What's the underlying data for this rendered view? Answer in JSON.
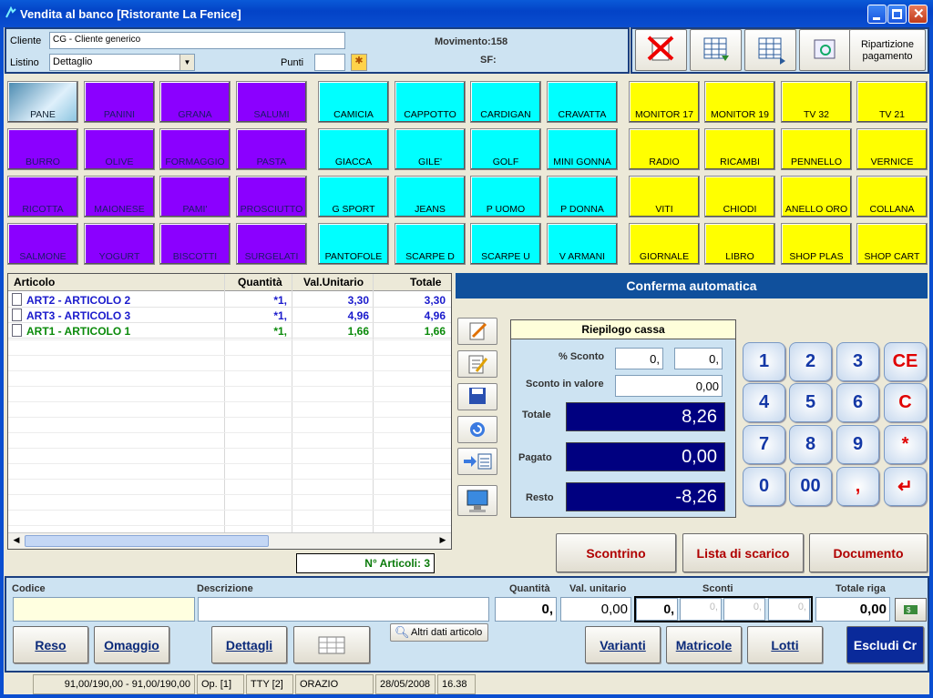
{
  "window": {
    "title": "Vendita al banco [Ristorante La Fenice]"
  },
  "header": {
    "cliente_label": "Cliente",
    "cliente_value": "CG - Cliente generico",
    "listino_label": "Listino",
    "listino_value": "Dettaglio",
    "punti_label": "Punti",
    "punti_value": "",
    "movimento": "Movimento:158",
    "sf": "SF:"
  },
  "toolbar": {
    "ripartizione_label": "Ripartizione pagamento"
  },
  "products": [
    {
      "label": "PANE",
      "color": "purple"
    },
    {
      "label": "PANINI",
      "color": "purple"
    },
    {
      "label": "GRANA",
      "color": "purple"
    },
    {
      "label": "SALUMI",
      "color": "purple"
    },
    {
      "label": "CAMICIA",
      "color": "cyan"
    },
    {
      "label": "CAPPOTTO",
      "color": "cyan"
    },
    {
      "label": "CARDIGAN",
      "color": "cyan"
    },
    {
      "label": "CRAVATTA",
      "color": "cyan"
    },
    {
      "label": "MONITOR 17",
      "color": "yellow"
    },
    {
      "label": "MONITOR 19",
      "color": "yellow"
    },
    {
      "label": "TV 32",
      "color": "yellow"
    },
    {
      "label": "TV 21",
      "color": "yellow"
    },
    {
      "label": "BURRO",
      "color": "purple"
    },
    {
      "label": "OLIVE",
      "color": "purple"
    },
    {
      "label": "FORMAGGIO",
      "color": "purple"
    },
    {
      "label": "PASTA",
      "color": "purple"
    },
    {
      "label": "GIACCA",
      "color": "cyan"
    },
    {
      "label": "GILE'",
      "color": "cyan"
    },
    {
      "label": "GOLF",
      "color": "cyan"
    },
    {
      "label": "MINI GONNA",
      "color": "cyan"
    },
    {
      "label": "RADIO",
      "color": "yellow"
    },
    {
      "label": "RICAMBI",
      "color": "yellow"
    },
    {
      "label": "PENNELLO",
      "color": "yellow"
    },
    {
      "label": "VERNICE",
      "color": "yellow"
    },
    {
      "label": "RICOTTA",
      "color": "purple"
    },
    {
      "label": "MAIONESE",
      "color": "purple"
    },
    {
      "label": "PAMI'",
      "color": "purple"
    },
    {
      "label": "PROSCIUTTO",
      "color": "purple"
    },
    {
      "label": "G SPORT",
      "color": "cyan"
    },
    {
      "label": "JEANS",
      "color": "cyan"
    },
    {
      "label": "P UOMO",
      "color": "cyan"
    },
    {
      "label": "P DONNA",
      "color": "cyan"
    },
    {
      "label": "VITI",
      "color": "yellow"
    },
    {
      "label": "CHIODI",
      "color": "yellow"
    },
    {
      "label": "ANELLO ORO",
      "color": "yellow"
    },
    {
      "label": "COLLANA",
      "color": "yellow"
    },
    {
      "label": "SALMONE",
      "color": "purple"
    },
    {
      "label": "YOGURT",
      "color": "purple"
    },
    {
      "label": "BISCOTTI",
      "color": "purple"
    },
    {
      "label": "SURGELATI",
      "color": "purple"
    },
    {
      "label": "PANTOFOLE",
      "color": "cyan"
    },
    {
      "label": "SCARPE D",
      "color": "cyan"
    },
    {
      "label": "SCARPE U",
      "color": "cyan"
    },
    {
      "label": "V ARMANI",
      "color": "cyan"
    },
    {
      "label": "GIORNALE",
      "color": "yellow"
    },
    {
      "label": "LIBRO",
      "color": "yellow"
    },
    {
      "label": "SHOP PLAS",
      "color": "yellow"
    },
    {
      "label": "SHOP CART",
      "color": "yellow"
    }
  ],
  "grid": {
    "headers": [
      "Articolo",
      "Quantità",
      "Val.Unitario",
      "Totale"
    ],
    "rows": [
      {
        "articolo": "ART2 - ARTICOLO 2",
        "quantita": "*1,",
        "val": "3,30",
        "totale": "3,30",
        "color": "#1a1acc"
      },
      {
        "articolo": "ART3 - ARTICOLO 3",
        "quantita": "*1,",
        "val": "4,96",
        "totale": "4,96",
        "color": "#1a1acc"
      },
      {
        "articolo": "ART1 - ARTICOLO 1",
        "quantita": "*1,",
        "val": "1,66",
        "totale": "1,66",
        "color": "#0a8a0a"
      }
    ],
    "n_articoli": "N° Articoli: 3"
  },
  "conferma": "Conferma automatica",
  "riepilogo": {
    "title": "Riepilogo cassa",
    "sconto_pct_label": "% Sconto",
    "sconto_pct_1": "0,",
    "sconto_pct_2": "0,",
    "sconto_val_label": "Sconto in valore",
    "sconto_val": "0,00",
    "totale_label": "Totale",
    "totale": "8,26",
    "pagato_label": "Pagato",
    "pagato": "0,00",
    "resto_label": "Resto",
    "resto": "-8,26"
  },
  "keypad": [
    [
      "1",
      "2",
      "3",
      "CE"
    ],
    [
      "4",
      "5",
      "6",
      "C"
    ],
    [
      "7",
      "8",
      "9",
      "*"
    ],
    [
      "0",
      "00",
      ",",
      "↵"
    ]
  ],
  "actions": {
    "scontrino": "Scontrino",
    "lista": "Lista di scarico",
    "documento": "Documento"
  },
  "entry": {
    "codice_label": "Codice",
    "descrizione_label": "Descrizione",
    "quantita_label": "Quantità",
    "val_label": "Val. unitario",
    "sconti_label": "Sconti",
    "totale_label": "Totale riga",
    "quantita": "0,",
    "val": "0,00",
    "sconto1": "0,",
    "sconto2": "0,",
    "sconto3": "0,",
    "sconto4": "0,",
    "totale": "0,00",
    "codice": "",
    "descrizione": ""
  },
  "bottom": {
    "reso": "Reso",
    "omaggio": "Omaggio",
    "dettagli": "Dettagli",
    "altri": "Altri dati articolo",
    "varianti": "Varianti",
    "matricole": "Matricole",
    "lotti": "Lotti",
    "escludi": "Escludi Cr"
  },
  "status": {
    "s1": "91,00/190,00 - 91,00/190,00",
    "s2": "Op. [1]",
    "s3": "TTY [2]",
    "s4": "ORAZIO",
    "s5": "28/05/2008",
    "s6": "16.38"
  }
}
